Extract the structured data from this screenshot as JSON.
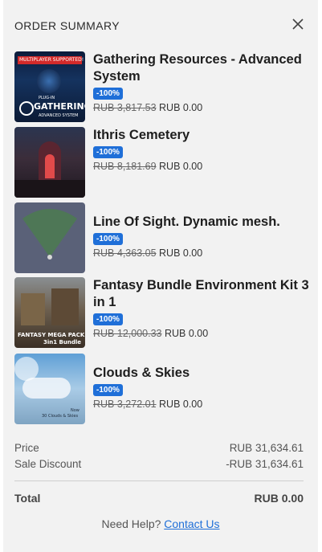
{
  "header": {
    "title": "ORDER SUMMARY"
  },
  "items": [
    {
      "name": "Gathering Resources - Advanced System",
      "badge": "-100%",
      "old_price": "RUB 3,817.53",
      "new_price": "RUB 0.00",
      "thumb_banner": "MULTIPLAYER SUPPORTED!",
      "thumb_small": "PLUG-IN",
      "thumb_title": "GATHERING",
      "thumb_sub": "ADVANCED SYSTEM"
    },
    {
      "name": "Ithris Cemetery",
      "badge": "-100%",
      "old_price": "RUB 8,181.69",
      "new_price": "RUB 0.00"
    },
    {
      "name": "Line Of Sight. Dynamic mesh.",
      "badge": "-100%",
      "old_price": "RUB 4,363.05",
      "new_price": "RUB 0.00"
    },
    {
      "name": "Fantasy Bundle Environment Kit 3 in 1",
      "badge": "-100%",
      "old_price": "RUB 12,000.33",
      "new_price": "RUB 0.00",
      "thumb_title": "FANTASY MEGA PACK",
      "thumb_sub": "3in1 Bundle"
    },
    {
      "name": "Clouds & Skies",
      "badge": "-100%",
      "old_price": "RUB 3,272.01",
      "new_price": "RUB 0.00",
      "thumb_title": "Now",
      "thumb_sub": "30 Clouds & Skies"
    }
  ],
  "summary": {
    "price_label": "Price",
    "price_value": "RUB 31,634.61",
    "discount_label": "Sale Discount",
    "discount_value": "-RUB 31,634.61",
    "total_label": "Total",
    "total_value": "RUB 0.00"
  },
  "help": {
    "text": "Need Help?",
    "link": "Contact Us"
  },
  "colors": {
    "accent": "#1f6fd8",
    "panel_bg": "#f2f2f2"
  }
}
